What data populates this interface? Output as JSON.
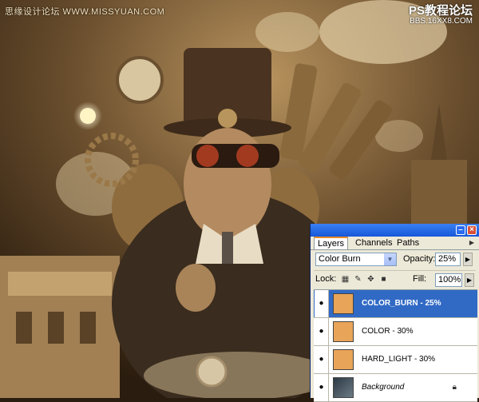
{
  "watermark": {
    "left": "思缘设计论坛 WWW.MISSYUAN.COM",
    "right_line1": "PS教程论坛",
    "right_line2": "BBS.16XX8.COM"
  },
  "layers_panel": {
    "tabs": [
      {
        "label": "Layers",
        "active": true
      },
      {
        "label": "Channels",
        "active": false
      },
      {
        "label": "Paths",
        "active": false
      }
    ],
    "blend_mode": "Color Burn",
    "opacity_label": "Opacity:",
    "opacity_value": "25%",
    "lock_label": "Lock:",
    "fill_label": "Fill:",
    "fill_value": "100%",
    "layers": [
      {
        "name": "COLOR_BURN - 25%",
        "selected": true,
        "thumb_color": "#e8a458"
      },
      {
        "name": "COLOR - 30%",
        "selected": false,
        "thumb_color": "#e8a458"
      },
      {
        "name": "HARD_LIGHT - 30%",
        "selected": false,
        "thumb_color": "#e8a458"
      },
      {
        "name": "Background",
        "selected": false,
        "thumb_color": "#2d3a45",
        "locked": true
      }
    ]
  },
  "colors": {
    "selection": "#316ac5",
    "titlebar": "#1657d8",
    "layer_fill": "#e8a458"
  }
}
